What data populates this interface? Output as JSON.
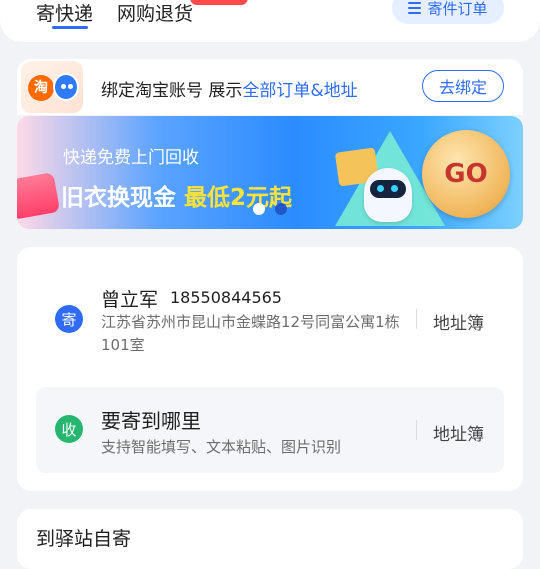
{
  "tabs": {
    "send": "寄快递",
    "return": "网购退货"
  },
  "orders_button": "寄件订单",
  "taobao": {
    "logo_char": "淘",
    "bind_prefix": "绑定淘宝账号 展示",
    "bind_highlight": "全部订单&地址",
    "bind_button": "去绑定"
  },
  "banner": {
    "subtitle": "快递免费上门回收",
    "title": "旧衣换现金",
    "title_highlight": "最低2元起",
    "go": "GO",
    "dots": 2
  },
  "sender": {
    "tag": "寄",
    "name": "曾立军",
    "phone": "18550844565",
    "address": "江苏省苏州市昆山市金蝶路12号同富公寓1栋101室",
    "book": "地址簿"
  },
  "receiver": {
    "tag": "收",
    "title": "要寄到哪里",
    "hint": "支持智能填写、文本粘贴、图片识别",
    "book": "地址簿"
  },
  "bottom_section": {
    "title": "到驿站自寄"
  },
  "colors": {
    "accent": "#2f6bf7",
    "receive": "#25b66f",
    "highlight": "#ffe33b"
  }
}
